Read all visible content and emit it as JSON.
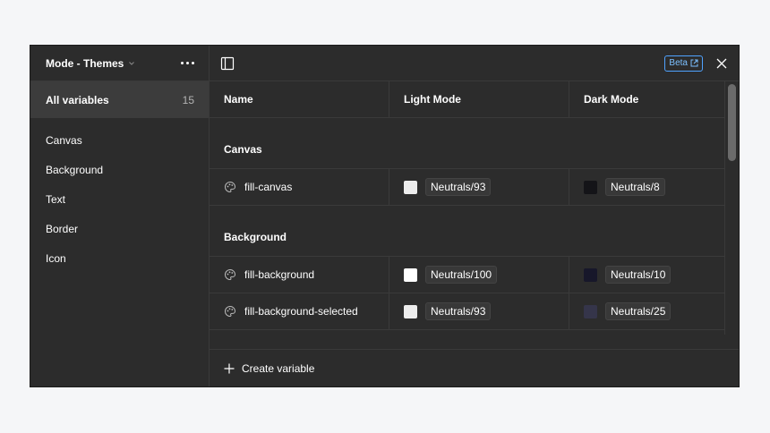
{
  "sidebar": {
    "title": "Mode - Themes",
    "all_variables": {
      "label": "All variables",
      "count": "15"
    },
    "items": [
      {
        "label": "Canvas"
      },
      {
        "label": "Background"
      },
      {
        "label": "Text"
      },
      {
        "label": "Border"
      },
      {
        "label": "Icon"
      }
    ]
  },
  "topbar": {
    "beta_label": "Beta",
    "icons": [
      "panel-toggle-icon",
      "external-link-icon",
      "close-icon"
    ]
  },
  "table": {
    "headers": {
      "name": "Name",
      "light": "Light Mode",
      "dark": "Dark Mode"
    },
    "groups": [
      {
        "name": "Canvas",
        "rows": [
          {
            "name": "fill-canvas",
            "light": "Neutrals/93",
            "light_color": "#ededed",
            "dark": "Neutrals/8",
            "dark_color": "#141418"
          }
        ]
      },
      {
        "name": "Background",
        "rows": [
          {
            "name": "fill-background",
            "light": "Neutrals/100",
            "light_color": "#ffffff",
            "dark": "Neutrals/10",
            "dark_color": "#17172a"
          },
          {
            "name": "fill-background-selected",
            "light": "Neutrals/93",
            "light_color": "#ededed",
            "dark": "Neutrals/25",
            "dark_color": "#35354a"
          }
        ]
      }
    ]
  },
  "footer": {
    "create_label": "Create variable"
  },
  "colors": {
    "panel_bg": "#2c2c2c",
    "accent": "#4fa3ff",
    "divider": "#3a3a3a"
  }
}
